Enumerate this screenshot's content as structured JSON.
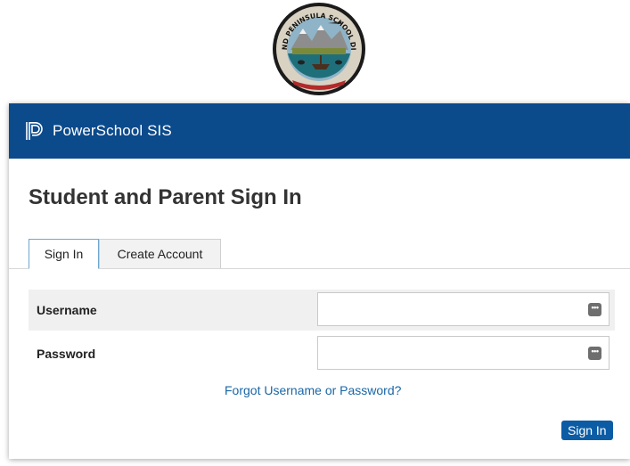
{
  "logo": {
    "name": "district-seal",
    "text": "LAKE AND PENINSULA SCHOOL DISTRICT"
  },
  "header": {
    "brand": "PowerSchool SIS",
    "brand_color": "#0b4a8b"
  },
  "page": {
    "title": "Student and Parent Sign In"
  },
  "tabs": [
    {
      "label": "Sign In",
      "active": true
    },
    {
      "label": "Create Account",
      "active": false
    }
  ],
  "form": {
    "username_label": "Username",
    "username_value": "",
    "password_label": "Password",
    "password_value": "",
    "autofill_icon": "more-dots-icon",
    "forgot_link": "Forgot Username or Password?",
    "submit_label": "Sign In"
  },
  "colors": {
    "accent": "#0b5ca5",
    "link": "#1a66a6"
  }
}
